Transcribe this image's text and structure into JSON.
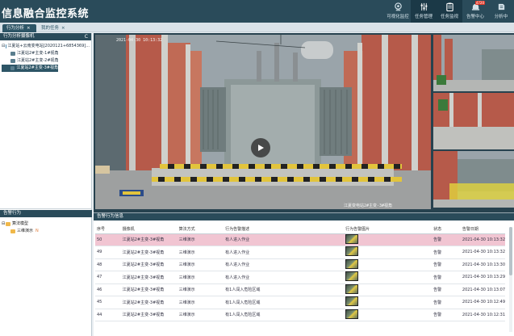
{
  "app": {
    "title": "信息融合监控系统"
  },
  "nav": [
    {
      "label": "可视化监控",
      "icon": "monitor-icon"
    },
    {
      "label": "任务管理",
      "icon": "sliders-icon",
      "active": true
    },
    {
      "label": "任务监视",
      "icon": "clipboard-icon",
      "active": true
    },
    {
      "label": "告警中心",
      "icon": "alarm-icon",
      "badge": "4720"
    },
    {
      "label": "分析中",
      "icon": "analysis-icon"
    }
  ],
  "tabs": [
    {
      "label": "行为分析",
      "close": "×"
    },
    {
      "label": "我的任务",
      "close": "×"
    }
  ],
  "left_panel": {
    "title": "行为分析摄像机",
    "refresh": "C",
    "tree": [
      {
        "label": "江夏站+云南变电站[2020121+6854369]...",
        "level": 0,
        "icon": "network-icon"
      },
      {
        "label": "江夏站2#主变-1#视角",
        "level": 1,
        "icon": "camera-icon"
      },
      {
        "label": "江夏站2#主变-2#视角",
        "level": 1,
        "icon": "camera-icon"
      },
      {
        "label": "江夏站2#主变-3#视角",
        "level": 1,
        "icon": "camera-icon",
        "selected": true
      }
    ],
    "section2_title": "告警行为",
    "tree2": [
      {
        "label": "算法模型",
        "level": 0,
        "icon": "folder-icon"
      },
      {
        "label": "三维演示",
        "level": 1,
        "icon": "folder-icon",
        "tag": "N"
      }
    ]
  },
  "main_video": {
    "timestamp_top": "2021-04-30 10:13:32",
    "watermark": "江夏变电站2#主变-3#视角"
  },
  "side_videos": [
    {
      "label": "thumb-1"
    },
    {
      "label": "thumb-2"
    },
    {
      "label": "thumb-3"
    }
  ],
  "table": {
    "title": "告警行为信息",
    "columns": [
      "序号",
      "摄像机",
      "算法方式",
      "行为告警描述",
      "行为告警图片",
      "状态",
      "告警日期"
    ],
    "rows": [
      {
        "id": "50",
        "camera": "江夏站2#主变-3#视角",
        "method": "三维演示",
        "desc": "有人进入作业",
        "status": "告警",
        "date": "2021-04-30 10:13:32",
        "highlight": true
      },
      {
        "id": "49",
        "camera": "江夏站2#主变-3#视角",
        "method": "三维演示",
        "desc": "有人进入作业",
        "status": "告警",
        "date": "2021-04-30 10:13:32"
      },
      {
        "id": "48",
        "camera": "江夏站2#主变-3#视角",
        "method": "三维演示",
        "desc": "有人进入作业",
        "status": "告警",
        "date": "2021-04-30 10:13:30"
      },
      {
        "id": "47",
        "camera": "江夏站2#主变-3#视角",
        "method": "三维演示",
        "desc": "有人进入作业",
        "status": "告警",
        "date": "2021-04-30 10:13:29"
      },
      {
        "id": "46",
        "camera": "江夏站2#主变-3#视角",
        "method": "三维演示",
        "desc": "有1人闯入危险区域",
        "status": "告警",
        "date": "2021-04-30 10:13:07"
      },
      {
        "id": "45",
        "camera": "江夏站2#主变-3#视角",
        "method": "三维演示",
        "desc": "有1人闯入危险区域",
        "status": "告警",
        "date": "2021-04-30 10:12:49"
      },
      {
        "id": "44",
        "camera": "江夏站2#主变-3#视角",
        "method": "三维演示",
        "desc": "有1人闯入危险区域",
        "status": "告警",
        "date": "2021-04-30 10:12:31"
      }
    ]
  },
  "colors": {
    "header": "#2a4b5a",
    "row_highlight": "#f1c5d2",
    "alarm_badge": "#e03b2b"
  }
}
